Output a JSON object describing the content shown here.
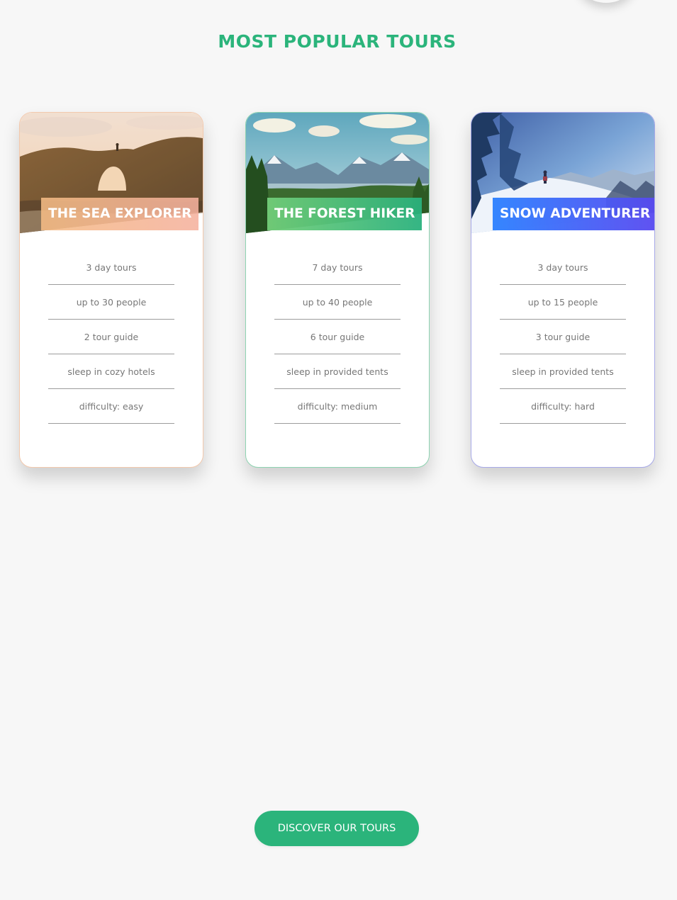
{
  "section": {
    "title": "MOST POPULAR TOURS"
  },
  "colors": {
    "accent": "#2bb47b",
    "background": "#f7f7f7",
    "card_1_gradient": [
      "#f4bb84",
      "#f5b19e"
    ],
    "card_2_gradient": [
      "#72ce79",
      "#2ab17d"
    ],
    "card_3_gradient": [
      "#2b80ff",
      "#5848f0"
    ]
  },
  "tours": [
    {
      "title": "THE SEA EXPLORER",
      "image": "sea-cliff-arch-photo",
      "details": [
        "3 day tours",
        "up to 30 people",
        "2 tour guide",
        "sleep in cozy hotels",
        "difficulty: easy"
      ]
    },
    {
      "title": "THE FOREST HIKER",
      "image": "mountain-forest-lake-photo",
      "details": [
        "7 day tours",
        "up to 40 people",
        "6 tour guide",
        "sleep in provided tents",
        "difficulty: medium"
      ]
    },
    {
      "title": "SNOW ADVENTURER",
      "image": "snowy-mountain-hiker-photo",
      "details": [
        "3 day tours",
        "up to 15 people",
        "3 tour guide",
        "sleep in provided tents",
        "difficulty: hard"
      ]
    }
  ],
  "cta": {
    "label": "DISCOVER OUR TOURS"
  }
}
